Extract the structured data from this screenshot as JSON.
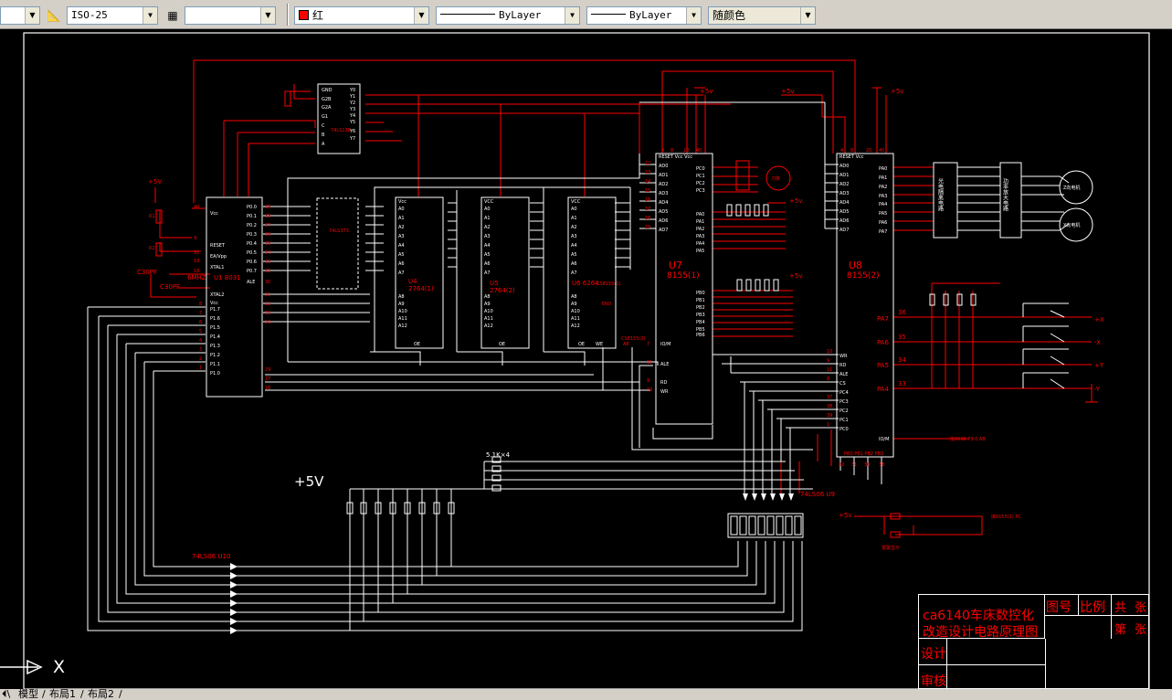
{
  "toolbar": {
    "dimstyle_value": "ISO-25",
    "tablestyle_value": "",
    "color_value": "红",
    "linetype_value": "ByLayer",
    "lineweight_value": "ByLayer",
    "plotstyle_value": "随颜色"
  },
  "schematic": {
    "chips": {
      "u1_label": "U1 8031",
      "u4_label": "U4",
      "u4_part": "2764(1)",
      "u5_label": "U5",
      "u5_part": "2764(2)",
      "u6_label": "U6 6264",
      "u7_label": "U7",
      "u7_part": "8155(1)",
      "u8_label": "U8",
      "u8_part": "8155(2)",
      "u9_label": "74LS06 U9",
      "u10_label": "74LS06 U10",
      "decoder_label": "74LS138",
      "latch_label": "74LS373"
    },
    "supply": {
      "plus5v": "+5V",
      "plus5v_small": "+5v",
      "plus5v_big": "+5V"
    },
    "components": {
      "resistor_pack": "5.1K×4",
      "crystal": "6MHZ",
      "cap1": "C30PF",
      "cap2": "C30PF",
      "r1": "R1",
      "r2": "R2"
    },
    "motors": {
      "z_motor": "Z向电机",
      "x_motor": "X向电机",
      "stepper": "刀架"
    },
    "blocks": {
      "opto": "光电隔离电路",
      "amp": "功率放大电路"
    },
    "limits": {
      "px_plus": "+X",
      "px_minus": "-X",
      "py_plus": "+Y",
      "py_minus": "-Y",
      "pin36": "36",
      "pin35": "35",
      "pin34": "34",
      "pin33": "33",
      "pa7": "PA7",
      "pa6": "PA6",
      "pa5": "PA5",
      "pa4": "PA4"
    },
    "alarm_text": "报警显示",
    "to8155_text": "接8155(1) PC",
    "to8031_text": "接8031 P3.0.AB"
  },
  "title_block": {
    "title_line1": "ca6140车床数控化",
    "title_line2": "改造设计电路原理图",
    "drawing_no": "图号",
    "scale": "比例",
    "total": "共",
    "sheet": "张",
    "page": "第",
    "sheet2": "张",
    "design": "设计",
    "review": "审核"
  },
  "ucs": {
    "x_label": "X"
  },
  "tabs": {
    "model": "模型",
    "layout1": "布局1",
    "layout2": "布局2"
  }
}
